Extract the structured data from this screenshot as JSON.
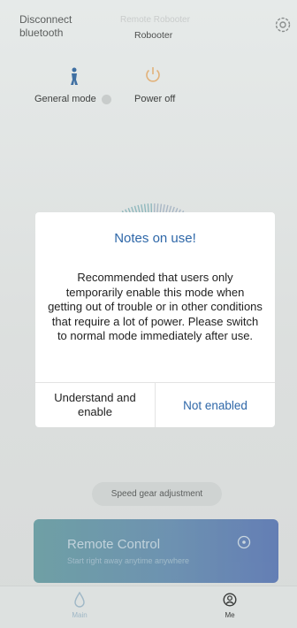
{
  "header": {
    "disconnect_label": "Disconnect\nbluetooth",
    "device_faint_label": "Remote Robooter",
    "device_name": "Robooter"
  },
  "modes": {
    "general_label": "General mode",
    "power_off_label": "Power off"
  },
  "dialog": {
    "title": "Notes on use!",
    "body": "Recommended that users only temporarily enable this mode when getting out of trouble or in other conditions that require a lot of power. Please switch to normal mode immediately after use.",
    "understand_button": "Understand and enable",
    "not_enabled_button": "Not enabled"
  },
  "speed_gear": {
    "label": "Speed gear adjustment"
  },
  "remote_control": {
    "title": "Remote Control",
    "subtitle": "Start right away anytime anywhere"
  },
  "tabbar": {
    "home_label": "Main",
    "me_label": "Me"
  },
  "colors": {
    "accent": "#2e67a8",
    "card_gradient_start": "#4c8c93",
    "card_gradient_end": "#3d5fa8"
  },
  "icons": {
    "settings": "gear-icon",
    "general_mode": "person-icon",
    "power_off": "power-icon",
    "remote": "target-icon",
    "home_tab": "water-drop-icon",
    "me_tab": "user-circle-icon"
  }
}
